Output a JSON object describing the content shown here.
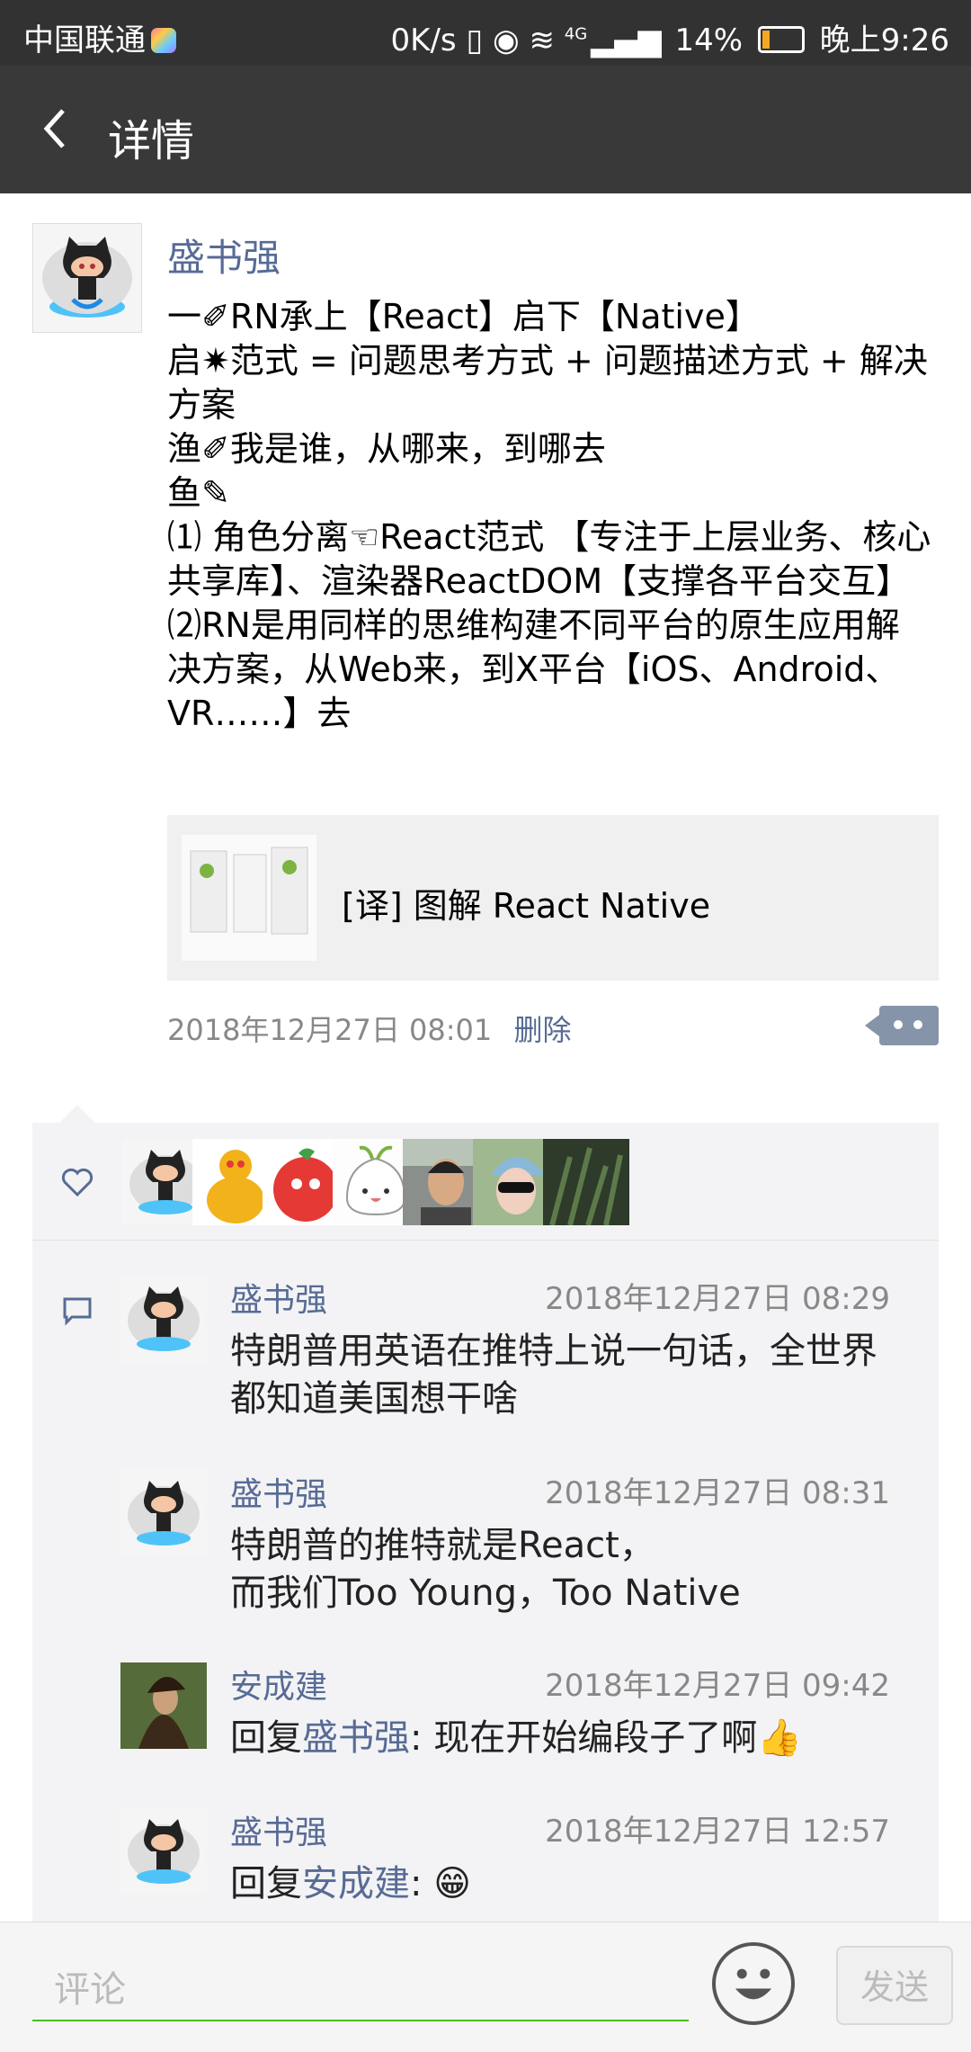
{
  "status_bar": {
    "carrier": "中国联通",
    "speed": "0K/s",
    "network": "4G",
    "battery": "14%",
    "time": "晚上9:26"
  },
  "header": {
    "title": "详情",
    "back_icon": "chevron-left-icon"
  },
  "post": {
    "author": "盛书强",
    "content": "一✐RN承上【React】启下【Native】\n启✷范式 = 问题思考方式 + 问题描述方式 + 解决方案\n渔✐我是谁，从哪来，到哪去\n鱼✎\n⑴ 角色分离☜React范式 【专注于上层业务、核心共享库】、渲染器ReactDOM【支撑各平台交互】\n⑵RN是用同样的思维构建不同平台的原生应用解决方案，从Web来，到X平台【iOS、Android、VR……】去",
    "link_title": "[译] 图解 React Native",
    "timestamp": "2018年12月27日 08:01",
    "delete_label": "删除"
  },
  "likes": {
    "count": 7
  },
  "comments": [
    {
      "name": "盛书强",
      "time": "2018年12月27日 08:29",
      "text": "特朗普用英语在推特上说一句话，全世界都知道美国想干啥"
    },
    {
      "name": "盛书强",
      "time": "2018年12月27日 08:31",
      "text": "特朗普的推特就是React，\n而我们Too Young，Too Native"
    },
    {
      "name": "安成建",
      "time": "2018年12月27日 09:42",
      "reply_prefix": "回复",
      "reply_to": "盛书强",
      "text": ": 现在开始编段子了啊👍"
    },
    {
      "name": "盛书强",
      "time": "2018年12月27日 12:57",
      "reply_prefix": "回复",
      "reply_to": "安成建",
      "text": ": 😁"
    }
  ],
  "footer": {
    "comment_placeholder": "评论",
    "send_label": "发送"
  },
  "colors": {
    "link": "#576b95",
    "topbar": "#393939",
    "accent": "#45c01a"
  }
}
